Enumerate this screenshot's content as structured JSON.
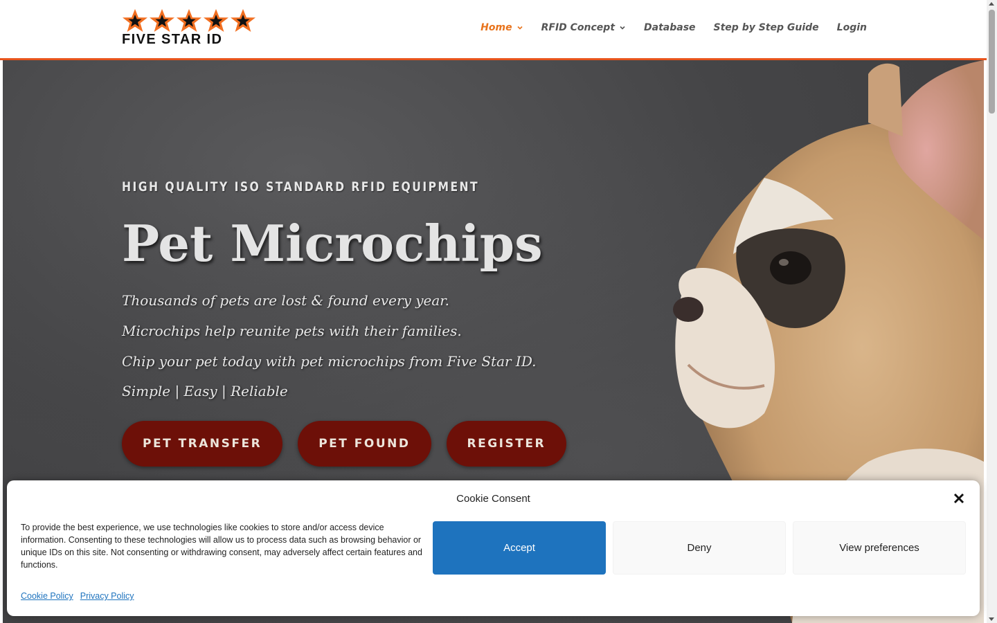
{
  "brand": {
    "name": "FIVE STAR ID",
    "star_color": "#f26f21"
  },
  "nav": {
    "items": [
      {
        "label": "Home",
        "has_dropdown": true,
        "active": true
      },
      {
        "label": "RFID Concept",
        "has_dropdown": true,
        "active": false
      },
      {
        "label": "Database",
        "has_dropdown": false,
        "active": false
      },
      {
        "label": "Step by Step Guide",
        "has_dropdown": false,
        "active": false
      },
      {
        "label": "Login",
        "has_dropdown": false,
        "active": false
      }
    ],
    "active_color": "#e8731c"
  },
  "hero": {
    "eyebrow": "HIGH QUALITY ISO STANDARD RFID EQUIPMENT",
    "headline": "Pet Microchips",
    "taglines": [
      "Thousands of pets are lost & found every year.",
      "Microchips help reunite pets with their families.",
      "Chip your pet today with pet microchips from Five Star ID.",
      "Simple | Easy | Reliable"
    ],
    "buttons": [
      "PET TRANSFER",
      "PET FOUND",
      "REGISTER"
    ],
    "button_color": "#6d1008"
  },
  "cookie": {
    "title": "Cookie Consent",
    "message": "To provide the best experience, we use technologies like cookies to store and/or access device information. Consenting to these technologies will allow us to process data such as browsing behavior or unique IDs on this site. Not consenting or withdrawing consent, may adversely affect certain features and functions.",
    "accept_label": "Accept",
    "deny_label": "Deny",
    "prefs_label": "View preferences",
    "links": [
      "Cookie Policy",
      "Privacy Policy"
    ],
    "accent_color": "#1e73be"
  }
}
